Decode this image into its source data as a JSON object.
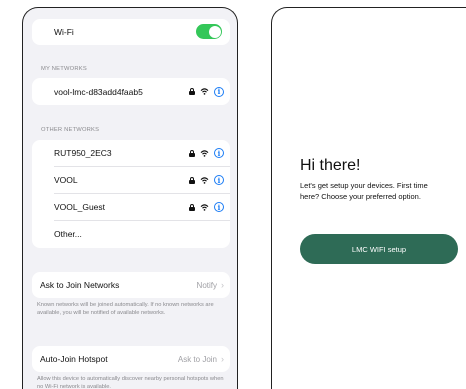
{
  "wifi": {
    "label": "Wi-Fi",
    "enabled": true,
    "toggle_color": "#34c759"
  },
  "my_networks": {
    "header": "MY NETWORKS",
    "items": [
      {
        "name": "vool-lmc-d83add4faab5",
        "locked": true
      }
    ]
  },
  "other_networks": {
    "header": "OTHER NETWORKS",
    "items": [
      {
        "name": "RUT950_2EC3",
        "locked": true
      },
      {
        "name": "VOOL",
        "locked": true
      },
      {
        "name": "VOOL_Guest",
        "locked": true
      }
    ],
    "other_label": "Other..."
  },
  "ask_to_join": {
    "label": "Ask to Join Networks",
    "value": "Notify",
    "footnote": "Known networks will be joined automatically. If no known networks are available, you will be notified of available networks."
  },
  "auto_join": {
    "label": "Auto-Join Hotspot",
    "value": "Ask to Join",
    "footnote": "Allow this device to automatically discover nearby personal hotspots when no Wi-Fi network is available."
  },
  "welcome": {
    "title": "Hi there!",
    "subtitle": "Let's get setup your devices. First time here? Choose your preferred option.",
    "button_label": "LMC WIFI setup",
    "button_color": "#2e6b56"
  },
  "icons": {
    "lock": "lock-icon",
    "wifi": "wifi-icon",
    "info": "info-icon",
    "chevron": "chevron-right-icon"
  },
  "accent_color": "#1a7cf5"
}
